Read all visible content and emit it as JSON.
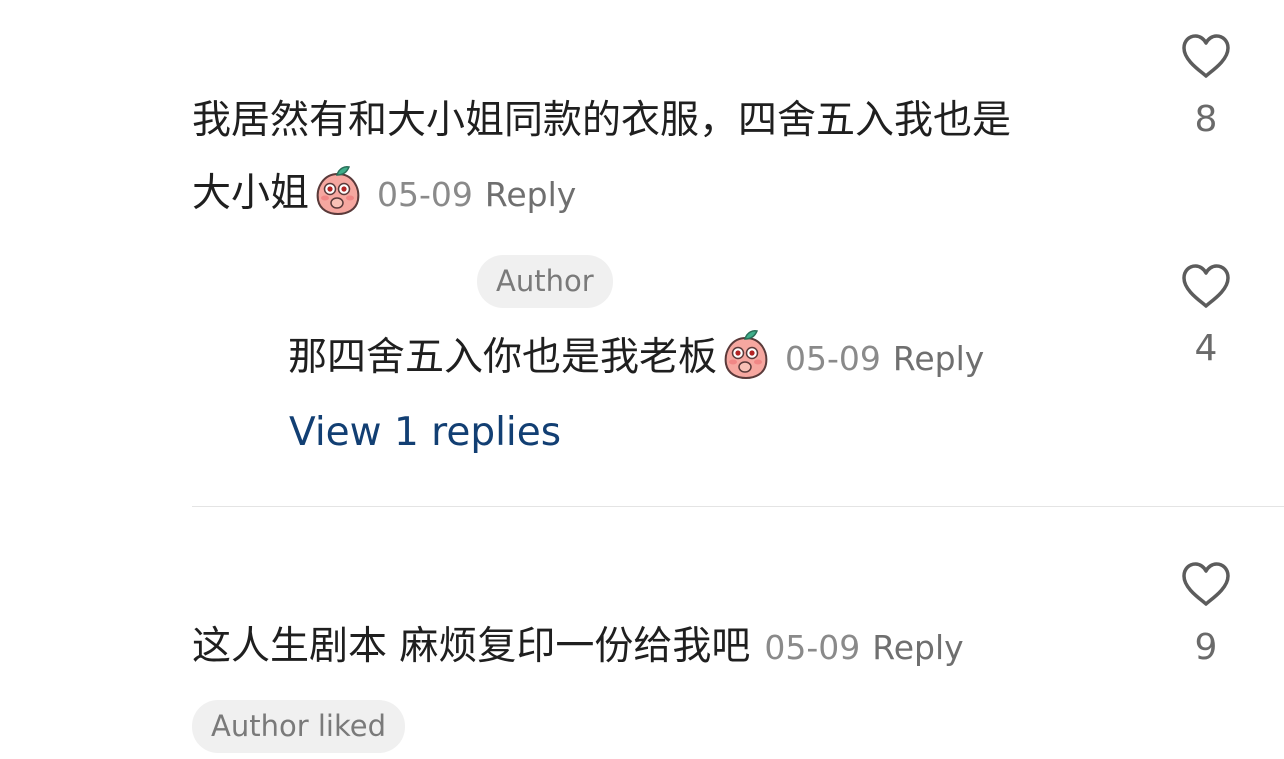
{
  "comments": [
    {
      "text_line1": "我居然有和大小姐同款的衣服，四舍五入我也是",
      "text_line2": "大小姐",
      "emoji": "shy-peach-emoji",
      "date": "05-09",
      "reply_label": "Reply",
      "likes": "8"
    },
    {
      "badge": "Author",
      "text": "那四舍五入你也是我老板",
      "emoji": "shy-peach-emoji",
      "date": "05-09",
      "reply_label": "Reply",
      "likes": "4",
      "view_replies": "View 1 replies"
    },
    {
      "text": "这人生剧本 麻烦复印一份给我吧",
      "date": "05-09",
      "reply_label": "Reply",
      "likes": "9",
      "badge": "Author liked"
    }
  ],
  "icons": {
    "like": "heart-outline-icon",
    "emoji": "shy-peach-emoji"
  },
  "colors": {
    "text": "#1f1f1f",
    "meta": "#8a8a8a",
    "link": "#123f73",
    "badge_bg": "#f0f0f0"
  }
}
